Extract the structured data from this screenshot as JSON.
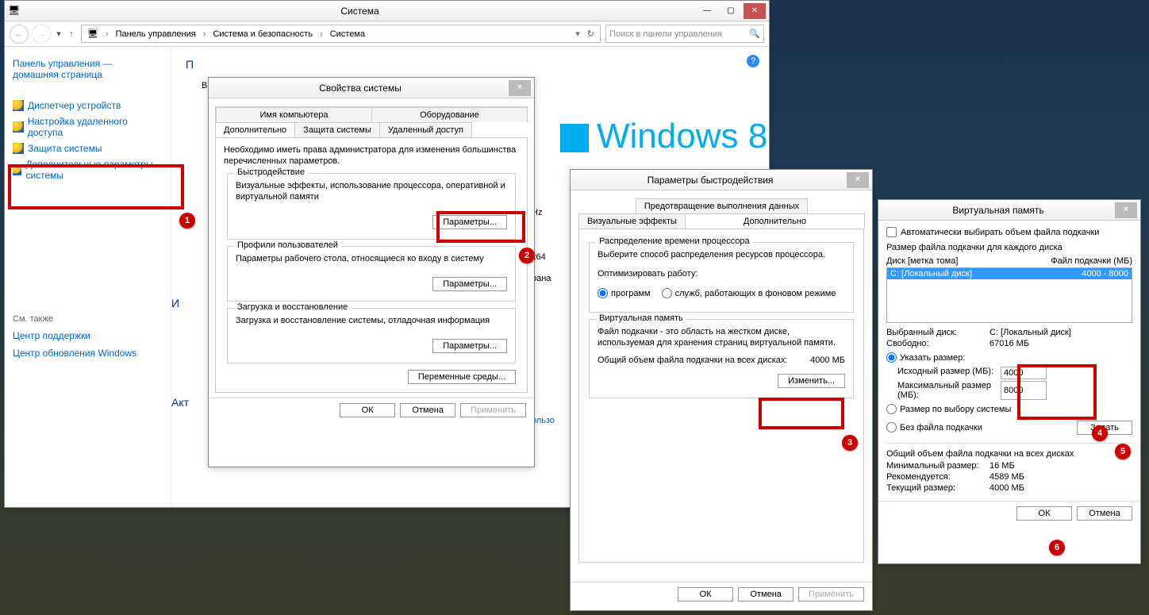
{
  "system_window": {
    "title": "Система",
    "breadcrumbs": [
      "Панель управления",
      "Система и безопасность",
      "Система"
    ],
    "search_placeholder": "Поиск в панели управления",
    "sidebar_header1": "Панель управления —",
    "sidebar_header2": "домашняя страница",
    "links": [
      "Диспетчер устройств",
      "Настройка удаленного доступа",
      "Защита системы",
      "Дополнительные параметры системы"
    ],
    "seealso_label": "См. также",
    "seealso_links": [
      "Центр поддержки",
      "Центр обновления Windows"
    ],
    "main_heading_prefix": "П",
    "main_sub": "Вы",
    "partials": {
      "hz": "Hz",
      "bit": "x64",
      "country": "рана",
      "im": "И",
      "akt": "Акт",
      "id": "пользо"
    },
    "logo_text": "Windows 8"
  },
  "sysprops": {
    "title": "Свойства системы",
    "tabs_top": [
      "Имя компьютера",
      "Оборудование"
    ],
    "tabs_bot": [
      "Дополнительно",
      "Защита системы",
      "Удаленный доступ"
    ],
    "intro": "Необходимо иметь права администратора для изменения большинства перечисленных параметров.",
    "group1_legend": "Быстродействие",
    "group1_text": "Визуальные эффекты, использование процессора, оперативной и виртуальной памяти",
    "group1_btn": "Параметры...",
    "group2_legend": "Профили пользователей",
    "group2_text": "Параметры рабочего стола, относящиеся ко входу в систему",
    "group2_btn": "Параметры...",
    "group3_legend": "Загрузка и восстановление",
    "group3_text": "Загрузка и восстановление системы, отладочная информация",
    "group3_btn": "Параметры...",
    "envvars_btn": "Переменные среды...",
    "ok": "ОК",
    "cancel": "Отмена",
    "apply": "Применить"
  },
  "perfopts": {
    "title": "Параметры быстродействия",
    "tabs_top": [
      "Предотвращение выполнения данных"
    ],
    "tabs_bot": [
      "Визуальные эффекты",
      "Дополнительно"
    ],
    "group1_legend": "Распределение времени процессора",
    "group1_text": "Выберите способ распределения ресурсов процессора.",
    "optimize_label": "Оптимизировать работу:",
    "radio_programs": "программ",
    "radio_services": "служб, работающих в фоновом режиме",
    "group2_legend": "Виртуальная память",
    "group2_text": "Файл подкачки - это область на жестком диске, используемая для хранения страниц виртуальной памяти.",
    "total_label": "Общий объем файла подкачки на всех дисках:",
    "total_value": "4000 МБ",
    "change_btn": "Изменить...",
    "ok": "ОК",
    "cancel": "Отмена",
    "apply": "Применить"
  },
  "vmem": {
    "title": "Виртуальная память",
    "auto_chk": "Автоматически выбирать объем файла подкачки",
    "per_drive": "Размер файла подкачки для каждого диска",
    "hdr_disk": "Диск [метка тома]",
    "hdr_pf": "Файл подкачки (МБ)",
    "row_disk": "C:    [Локальный диск]",
    "row_pf": "4000 - 8000",
    "sel_drive_label": "Выбранный диск:",
    "sel_drive_val": "C:  [Локальный диск]",
    "free_label": "Свободно:",
    "free_val": "67016 МБ",
    "custom_size": "Указать размер:",
    "initial_label": "Исходный размер (МБ):",
    "initial_val": "4000",
    "max_label": "Максимальный размер (МБ):",
    "max_val": "8000",
    "system_size": "Размер по выбору системы",
    "no_pf": "Без файла подкачки",
    "set_btn": "Задать",
    "all_label": "Общий объем файла подкачки на всех дисках",
    "min_label": "Минимальный размер:",
    "min_val": "16 МБ",
    "rec_label": "Рекомендуется:",
    "rec_val": "4589 МБ",
    "cur_label": "Текущий размер:",
    "cur_val": "4000 МБ",
    "ok": "ОК",
    "cancel": "Отмена"
  }
}
